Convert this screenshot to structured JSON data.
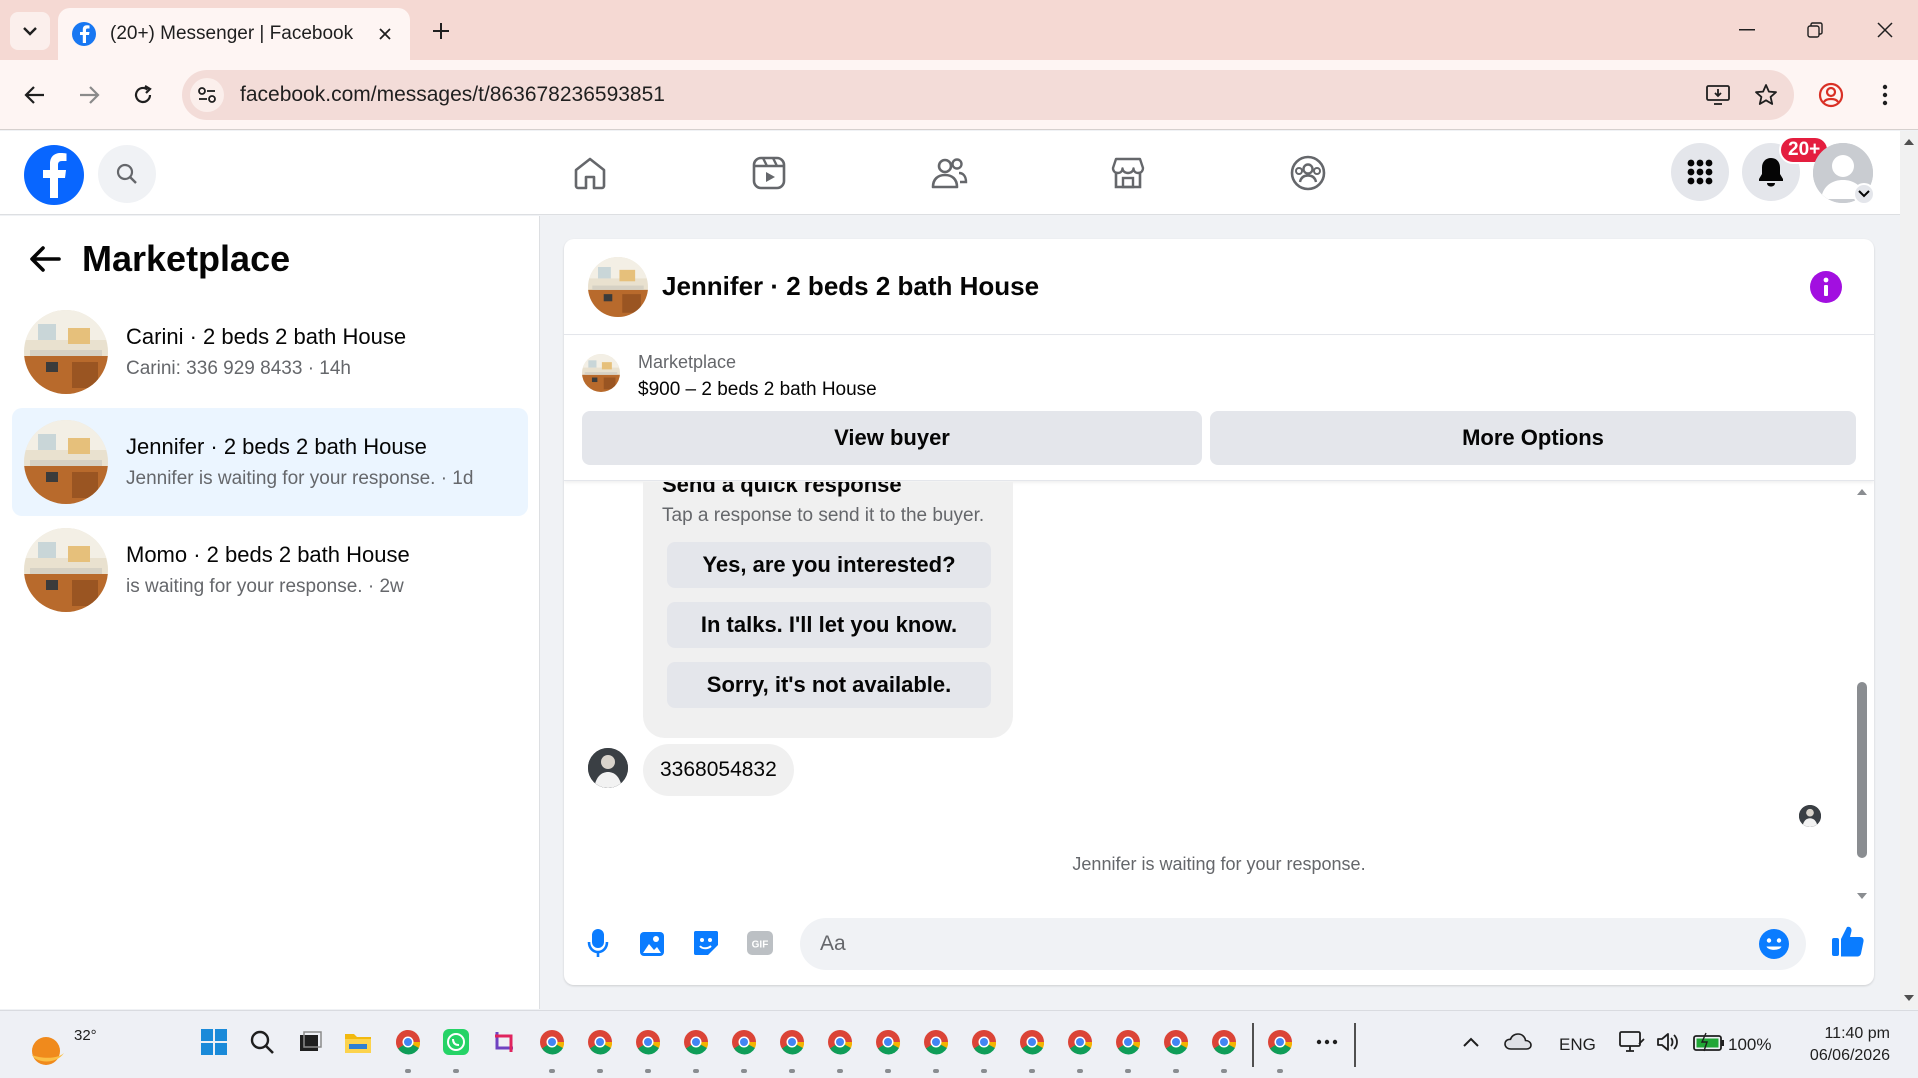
{
  "browser": {
    "tab_title": "(20+) Messenger | Facebook",
    "url": "facebook.com/messages/t/863678236593851"
  },
  "header": {
    "notification_count": "20+",
    "nav_items": [
      "home-icon",
      "video-icon",
      "friends-icon",
      "marketplace-icon",
      "groups-icon"
    ]
  },
  "sidebar": {
    "title": "Marketplace",
    "conversations": [
      {
        "name": "Carini · 2 beds 2 bath House",
        "preview": "Carini: 336 929 8433 · 14h",
        "active": false
      },
      {
        "name": "Jennifer · 2 beds 2 bath House",
        "preview": "Jennifer is waiting for your response. · 1d",
        "active": true
      },
      {
        "name": "Momo · 2 beds 2 bath House",
        "preview": "is waiting for your response. · 2w",
        "active": false
      }
    ]
  },
  "chat": {
    "title": "Jennifer · 2 beds 2 bath House",
    "listing": {
      "category": "Marketplace",
      "price_title": "$900 – 2 beds 2 bath House",
      "view_buyer_label": "View buyer",
      "more_options_label": "More Options"
    },
    "quick_response": {
      "title": "Send a quick response",
      "subtitle": "Tap a response to send it to the buyer.",
      "options": [
        "Yes, are you interested?",
        "In talks. I'll let you know.",
        "Sorry, it's not available."
      ]
    },
    "message_text": "3368054832",
    "waiting_text": "Jennifer is waiting for your response.",
    "composer_placeholder": "Aa"
  },
  "taskbar": {
    "temperature": "32°",
    "language": "ENG",
    "battery": "100%",
    "time": "11:40 pm",
    "date": "06/06/2026"
  },
  "colors": {
    "facebook_blue": "#0866ff",
    "messenger_blue": "#0a7cff",
    "info_purple": "#a20fe0",
    "badge_red": "#e41e3f",
    "active_row": "#ebf5ff"
  }
}
